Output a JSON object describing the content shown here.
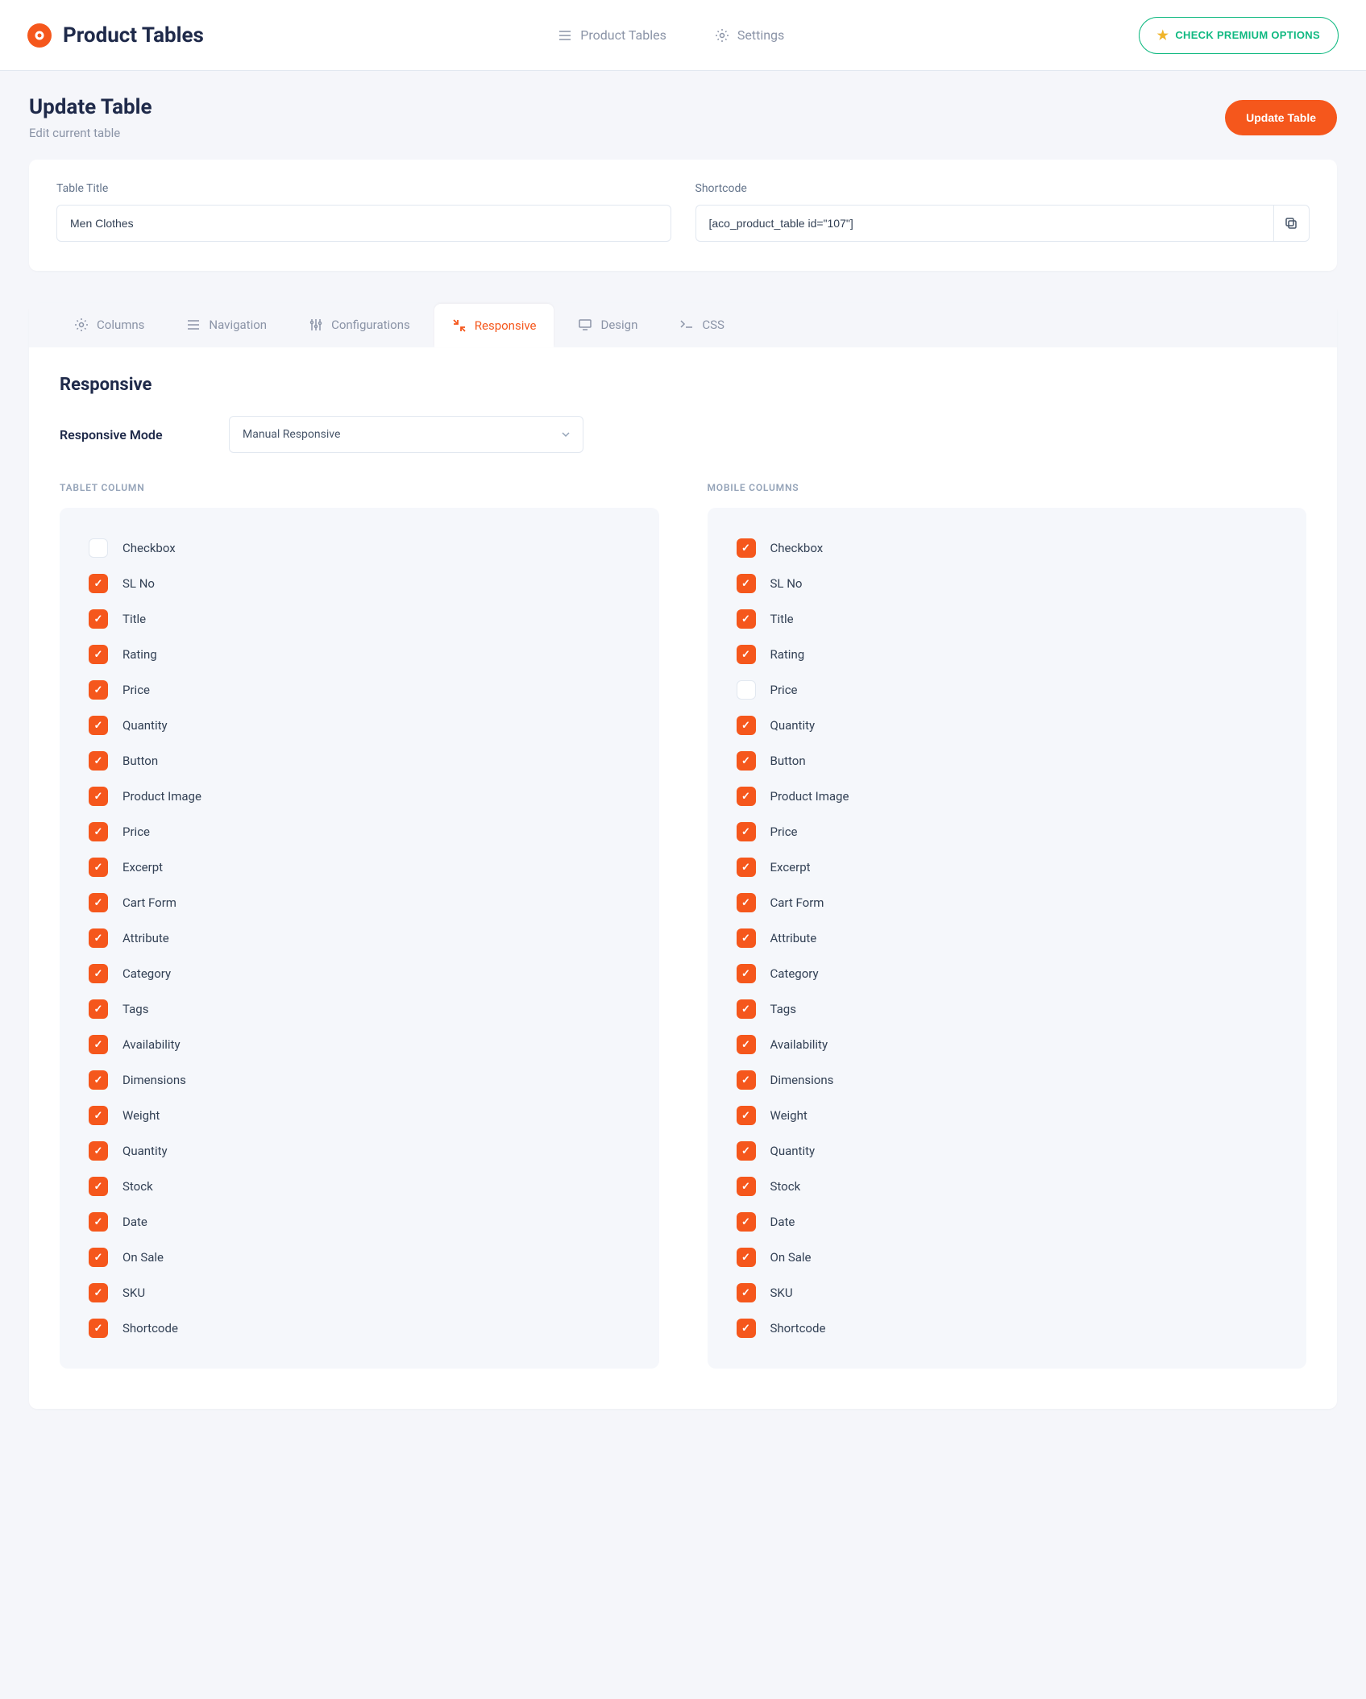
{
  "brand": {
    "title": "Product Tables"
  },
  "topnav": {
    "product_tables": "Product Tables",
    "settings": "Settings"
  },
  "premium_button": "CHECK PREMIUM OPTIONS",
  "page": {
    "title": "Update Table",
    "subtitle": "Edit current table",
    "action": "Update Table"
  },
  "form": {
    "table_title_label": "Table Title",
    "table_title_value": "Men Clothes",
    "shortcode_label": "Shortcode",
    "shortcode_value": "[aco_product_table id=\"107\"]"
  },
  "tabs": {
    "columns": "Columns",
    "navigation": "Navigation",
    "configurations": "Configurations",
    "responsive": "Responsive",
    "design": "Design",
    "css": "CSS"
  },
  "section": {
    "title": "Responsive",
    "mode_label": "Responsive Mode",
    "mode_value": "Manual Responsive"
  },
  "tablet": {
    "heading": "TABLET COLUMN",
    "items": [
      {
        "label": "Checkbox",
        "checked": false
      },
      {
        "label": "SL No",
        "checked": true
      },
      {
        "label": "Title",
        "checked": true
      },
      {
        "label": "Rating",
        "checked": true
      },
      {
        "label": "Price",
        "checked": true
      },
      {
        "label": "Quantity",
        "checked": true
      },
      {
        "label": "Button",
        "checked": true
      },
      {
        "label": "Product Image",
        "checked": true
      },
      {
        "label": "Price",
        "checked": true
      },
      {
        "label": "Excerpt",
        "checked": true
      },
      {
        "label": "Cart Form",
        "checked": true
      },
      {
        "label": "Attribute",
        "checked": true
      },
      {
        "label": "Category",
        "checked": true
      },
      {
        "label": "Tags",
        "checked": true
      },
      {
        "label": "Availability",
        "checked": true
      },
      {
        "label": "Dimensions",
        "checked": true
      },
      {
        "label": "Weight",
        "checked": true
      },
      {
        "label": "Quantity",
        "checked": true
      },
      {
        "label": "Stock",
        "checked": true
      },
      {
        "label": "Date",
        "checked": true
      },
      {
        "label": "On Sale",
        "checked": true
      },
      {
        "label": "SKU",
        "checked": true
      },
      {
        "label": "Shortcode",
        "checked": true
      }
    ]
  },
  "mobile": {
    "heading": "MOBILE COLUMNS",
    "items": [
      {
        "label": "Checkbox",
        "checked": true
      },
      {
        "label": "SL No",
        "checked": true
      },
      {
        "label": "Title",
        "checked": true
      },
      {
        "label": "Rating",
        "checked": true
      },
      {
        "label": "Price",
        "checked": false
      },
      {
        "label": "Quantity",
        "checked": true
      },
      {
        "label": "Button",
        "checked": true
      },
      {
        "label": "Product Image",
        "checked": true
      },
      {
        "label": "Price",
        "checked": true
      },
      {
        "label": "Excerpt",
        "checked": true
      },
      {
        "label": "Cart Form",
        "checked": true
      },
      {
        "label": "Attribute",
        "checked": true
      },
      {
        "label": "Category",
        "checked": true
      },
      {
        "label": "Tags",
        "checked": true
      },
      {
        "label": "Availability",
        "checked": true
      },
      {
        "label": "Dimensions",
        "checked": true
      },
      {
        "label": "Weight",
        "checked": true
      },
      {
        "label": "Quantity",
        "checked": true
      },
      {
        "label": "Stock",
        "checked": true
      },
      {
        "label": "Date",
        "checked": true
      },
      {
        "label": "On Sale",
        "checked": true
      },
      {
        "label": "SKU",
        "checked": true
      },
      {
        "label": "Shortcode",
        "checked": true
      }
    ]
  }
}
